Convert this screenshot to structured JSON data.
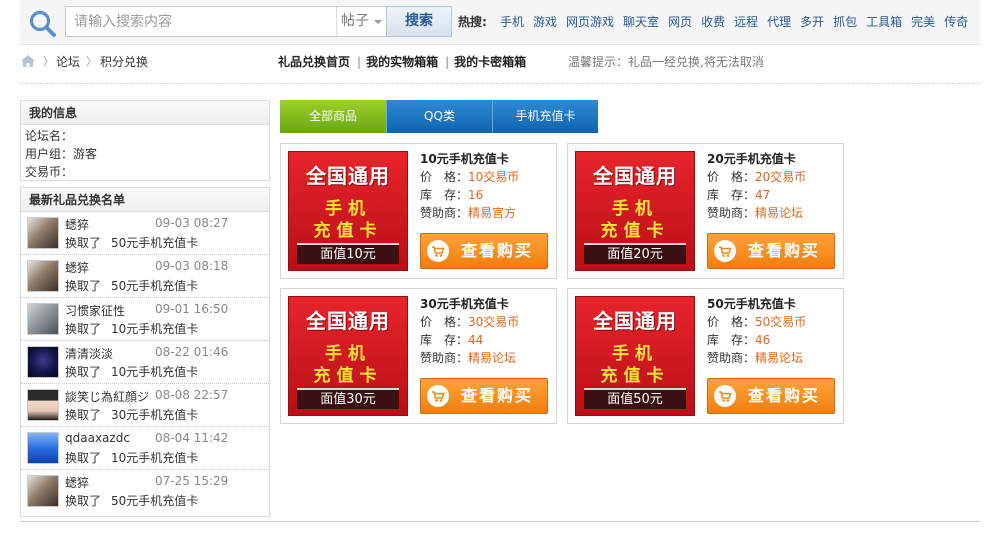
{
  "search": {
    "placeholder": "请输入搜索内容",
    "type": "帖子",
    "button": "搜索",
    "hot_label": "热搜:",
    "hot_links": [
      "手机",
      "游戏",
      "网页游戏",
      "聊天室",
      "网页",
      "收费",
      "远程",
      "代理",
      "多开",
      "抓包",
      "工具箱",
      "完美",
      "传奇"
    ]
  },
  "breadcrumb": [
    "论坛",
    "积分兑换"
  ],
  "nav": {
    "links": [
      "礼品兑换首页",
      "我的实物箱箱",
      "我的卡密箱箱"
    ],
    "tip": "温馨提示：礼品一经兑换,将无法取消"
  },
  "my_info": {
    "title": "我的信息",
    "rows": [
      "论坛名：",
      "用户组：游客",
      "交易币："
    ]
  },
  "records": {
    "title": "最新礼品兑换名单",
    "items": [
      {
        "name": "蟋猝",
        "time": "09-03 08:27",
        "action": "换取了",
        "item": "50元手机充值卡",
        "avatar": "anime"
      },
      {
        "name": "蟋猝",
        "time": "09-03 08:18",
        "action": "换取了",
        "item": "50元手机充值卡",
        "avatar": "anime"
      },
      {
        "name": "习惯家征性",
        "time": "09-01 16:50",
        "action": "换取了",
        "item": "10元手机充值卡",
        "avatar": "gray"
      },
      {
        "name": "清清淡淡",
        "time": "08-22 01:46",
        "action": "换取了",
        "item": "10元手机充值卡",
        "avatar": "dark"
      },
      {
        "name": "談笑じ為紅顔ジ",
        "time": "08-08 22:57",
        "action": "换取了",
        "item": "30元手机充值卡",
        "avatar": "girl"
      },
      {
        "name": "qdaaxazdc",
        "time": "08-04 11:42",
        "action": "换取了",
        "item": "10元手机充值卡",
        "avatar": "blue"
      },
      {
        "name": "蟋猝",
        "time": "07-25 15:29",
        "action": "换取了",
        "item": "50元手机充值卡",
        "avatar": "anime"
      }
    ]
  },
  "tabs": [
    "全部商品",
    "QQ类",
    "手机充值卡"
  ],
  "products": [
    {
      "title": "10元手机充值卡",
      "price_label": "价　格：",
      "price": "10交易币",
      "stock_label": "库　存：",
      "stock": "16",
      "sponsor_label": "赞助商：",
      "sponsor": "精易官方",
      "img_top": "全国通用",
      "img_mid1": "手机",
      "img_mid2": "充值卡",
      "img_face": "面值10元",
      "buy": "查看购买"
    },
    {
      "title": "20元手机充值卡",
      "price_label": "价　格：",
      "price": "20交易币",
      "stock_label": "库　存：",
      "stock": "47",
      "sponsor_label": "赞助商：",
      "sponsor": "精易论坛",
      "img_top": "全国通用",
      "img_mid1": "手机",
      "img_mid2": "充值卡",
      "img_face": "面值20元",
      "buy": "查看购买"
    },
    {
      "title": "30元手机充值卡",
      "price_label": "价　格：",
      "price": "30交易币",
      "stock_label": "库　存：",
      "stock": "44",
      "sponsor_label": "赞助商：",
      "sponsor": "精易论坛",
      "img_top": "全国通用",
      "img_mid1": "手机",
      "img_mid2": "充值卡",
      "img_face": "面值30元",
      "buy": "查看购买"
    },
    {
      "title": "50元手机充值卡",
      "price_label": "价　格：",
      "price": "50交易币",
      "stock_label": "库　存：",
      "stock": "46",
      "sponsor_label": "赞助商：",
      "sponsor": "精易论坛",
      "img_top": "全国通用",
      "img_mid1": "手机",
      "img_mid2": "充值卡",
      "img_face": "面值50元",
      "buy": "查看购买"
    }
  ],
  "colors": {
    "accent_orange": "#f07e0f",
    "tab_green": "#6aa516",
    "tab_blue": "#1062ae",
    "link_blue": "#2a5a93",
    "price_orange": "#e0651c"
  }
}
